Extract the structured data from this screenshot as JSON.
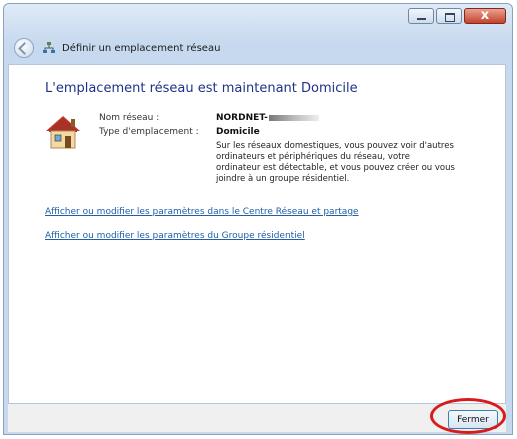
{
  "window": {
    "title": "Définir un emplacement réseau",
    "close_label": "x"
  },
  "page": {
    "heading": "L'emplacement réseau est maintenant Domicile",
    "network_name_label": "Nom réseau :",
    "network_name_value": "NORDNET-",
    "location_type_label": "Type d'emplacement :",
    "location_type_value": "Domicile",
    "description_lines": [
      "Sur les réseaux domestiques, vous pouvez voir d'autres",
      "ordinateurs et périphériques du réseau, votre",
      "ordinateur est détectable, et vous pouvez créer ou vous",
      "joindre à un groupe résidentiel."
    ],
    "links": [
      "Afficher ou modifier les paramètres dans le Centre Réseau et partage",
      "Afficher ou modifier les paramètres du Groupe résidentiel"
    ]
  },
  "footer": {
    "close_button_label": "Fermer"
  },
  "colors": {
    "heading": "#1e3287",
    "link": "#1f5ea8",
    "highlight_ring": "#d81b1b"
  },
  "icons": [
    "back-arrow-icon",
    "network-icon",
    "home-network-icon",
    "minimize-icon",
    "maximize-icon",
    "close-icon"
  ]
}
